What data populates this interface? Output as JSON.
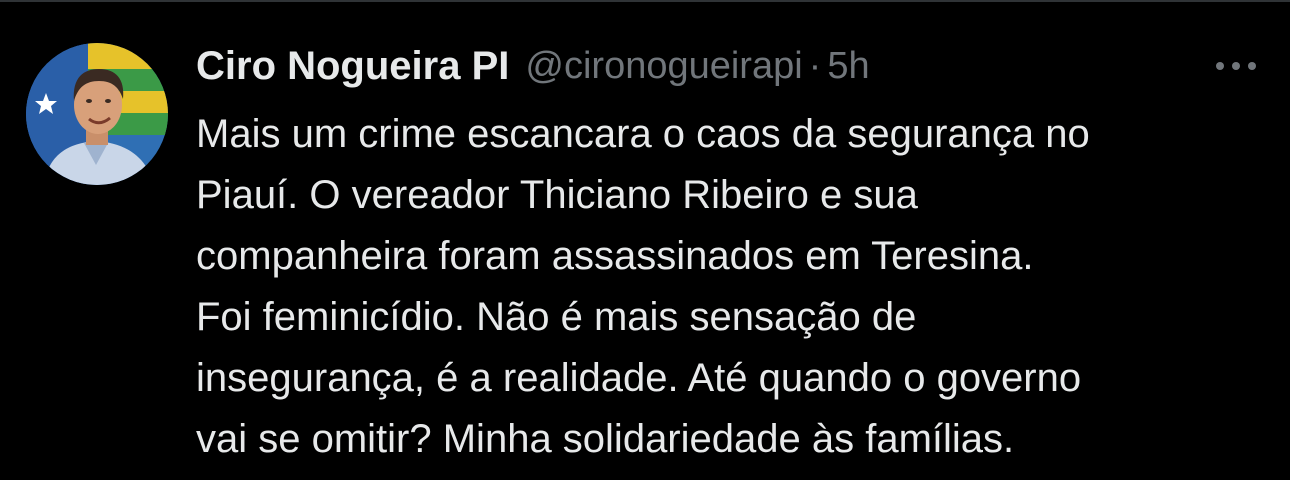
{
  "tweet": {
    "author": {
      "display_name": "Ciro Nogueira PI",
      "handle": "@cironogueirapi"
    },
    "separator": "·",
    "timestamp": "5h",
    "more_icon": "more-horizontal-icon",
    "text_lines": [
      "Mais um crime escancara o caos da segurança no",
      "Piauí. O vereador Thiciano Ribeiro e sua",
      "companheira foram assassinados em Teresina.",
      "Foi feminicídio. Não é mais sensação de",
      "insegurança, é a realidade. Até quando o governo",
      "vai se omitir? Minha solidariedade às famílias."
    ]
  },
  "colors": {
    "background": "#000000",
    "primary_text": "#e7e9ea",
    "secondary_text": "#71767b",
    "divider": "#2f3336"
  }
}
